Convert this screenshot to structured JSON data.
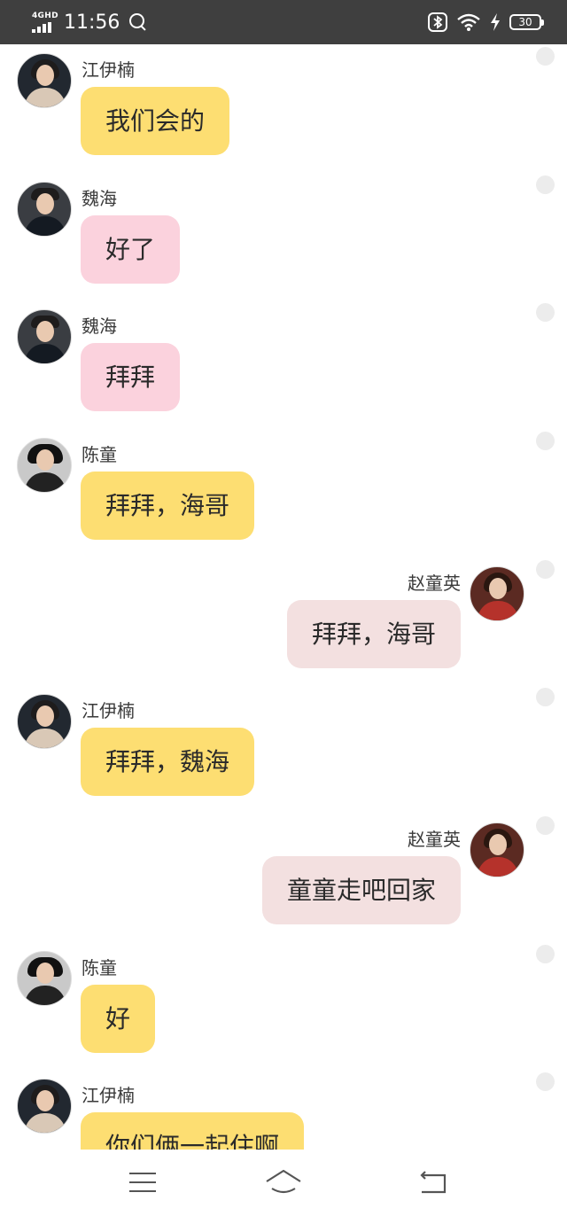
{
  "status_bar": {
    "network_label": "4GHD",
    "time": "11:56",
    "battery": "30",
    "icons": [
      "signal-icon",
      "search-icon",
      "bluetooth-icon",
      "wifi-icon",
      "charging-icon",
      "battery-icon"
    ]
  },
  "messages": [
    {
      "side": "left",
      "sender": "江伊楠",
      "text": "我们会的",
      "avatar": "avatar-jiang-yinan",
      "bubble_color": "#fdde72"
    },
    {
      "side": "left",
      "sender": "魏海",
      "text": "好了",
      "avatar": "avatar-wei-hai",
      "bubble_color": "#fbd2dd"
    },
    {
      "side": "left",
      "sender": "魏海",
      "text": "拜拜",
      "avatar": "avatar-wei-hai",
      "bubble_color": "#fbd2dd"
    },
    {
      "side": "left",
      "sender": "陈童",
      "text": "拜拜，海哥",
      "avatar": "avatar-chen-tong",
      "bubble_color": "#fdde72"
    },
    {
      "side": "right",
      "sender": "赵童英",
      "text": "拜拜，海哥",
      "avatar": "avatar-zhao-tongying",
      "bubble_color": "#f3e0e0"
    },
    {
      "side": "left",
      "sender": "江伊楠",
      "text": "拜拜，魏海",
      "avatar": "avatar-jiang-yinan",
      "bubble_color": "#fdde72"
    },
    {
      "side": "right",
      "sender": "赵童英",
      "text": "童童走吧回家",
      "avatar": "avatar-zhao-tongying",
      "bubble_color": "#f3e0e0"
    },
    {
      "side": "left",
      "sender": "陈童",
      "text": "好",
      "avatar": "avatar-chen-tong",
      "bubble_color": "#fdde72"
    },
    {
      "side": "left",
      "sender": "江伊楠",
      "text": "你们俩一起住啊",
      "avatar": "avatar-jiang-yinan",
      "bubble_color": "#fdde72"
    }
  ],
  "nav_bar": {
    "icons": [
      "menu-icon",
      "home-icon",
      "back-icon"
    ]
  }
}
